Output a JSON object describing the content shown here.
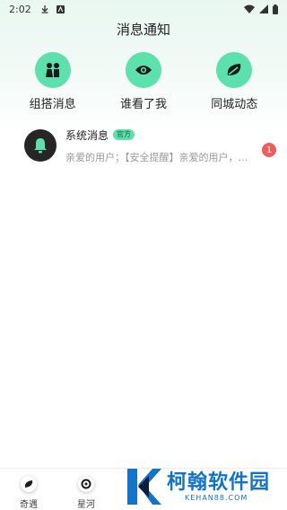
{
  "status_bar": {
    "time": "2:02",
    "icons": [
      "download-icon",
      "notification-a-icon",
      "wifi-icon",
      "signal-icon",
      "battery-icon"
    ]
  },
  "header": {
    "title": "消息通知"
  },
  "quick_actions": [
    {
      "label": "组搭消息",
      "icon": "couple-icon"
    },
    {
      "label": "谁看了我",
      "icon": "eye-icon"
    },
    {
      "label": "同城动态",
      "icon": "leaf-icon"
    }
  ],
  "messages": [
    {
      "title": "系统消息",
      "badge": "官方",
      "preview": "亲爱的用户；【安全提醒】亲爱的用户，…",
      "unread": "1",
      "icon": "bell-icon"
    }
  ],
  "bottom_nav": [
    {
      "label": "奇遇",
      "icon": "compass-icon"
    },
    {
      "label": "星河",
      "icon": "galaxy-icon"
    }
  ],
  "watermark": {
    "title": "柯翰软件园",
    "subtitle": "KEHAN88.COM"
  },
  "colors": {
    "accent": "#5ee0ad",
    "badge_red": "#f05b5b",
    "watermark_blue": "#1273c8"
  }
}
